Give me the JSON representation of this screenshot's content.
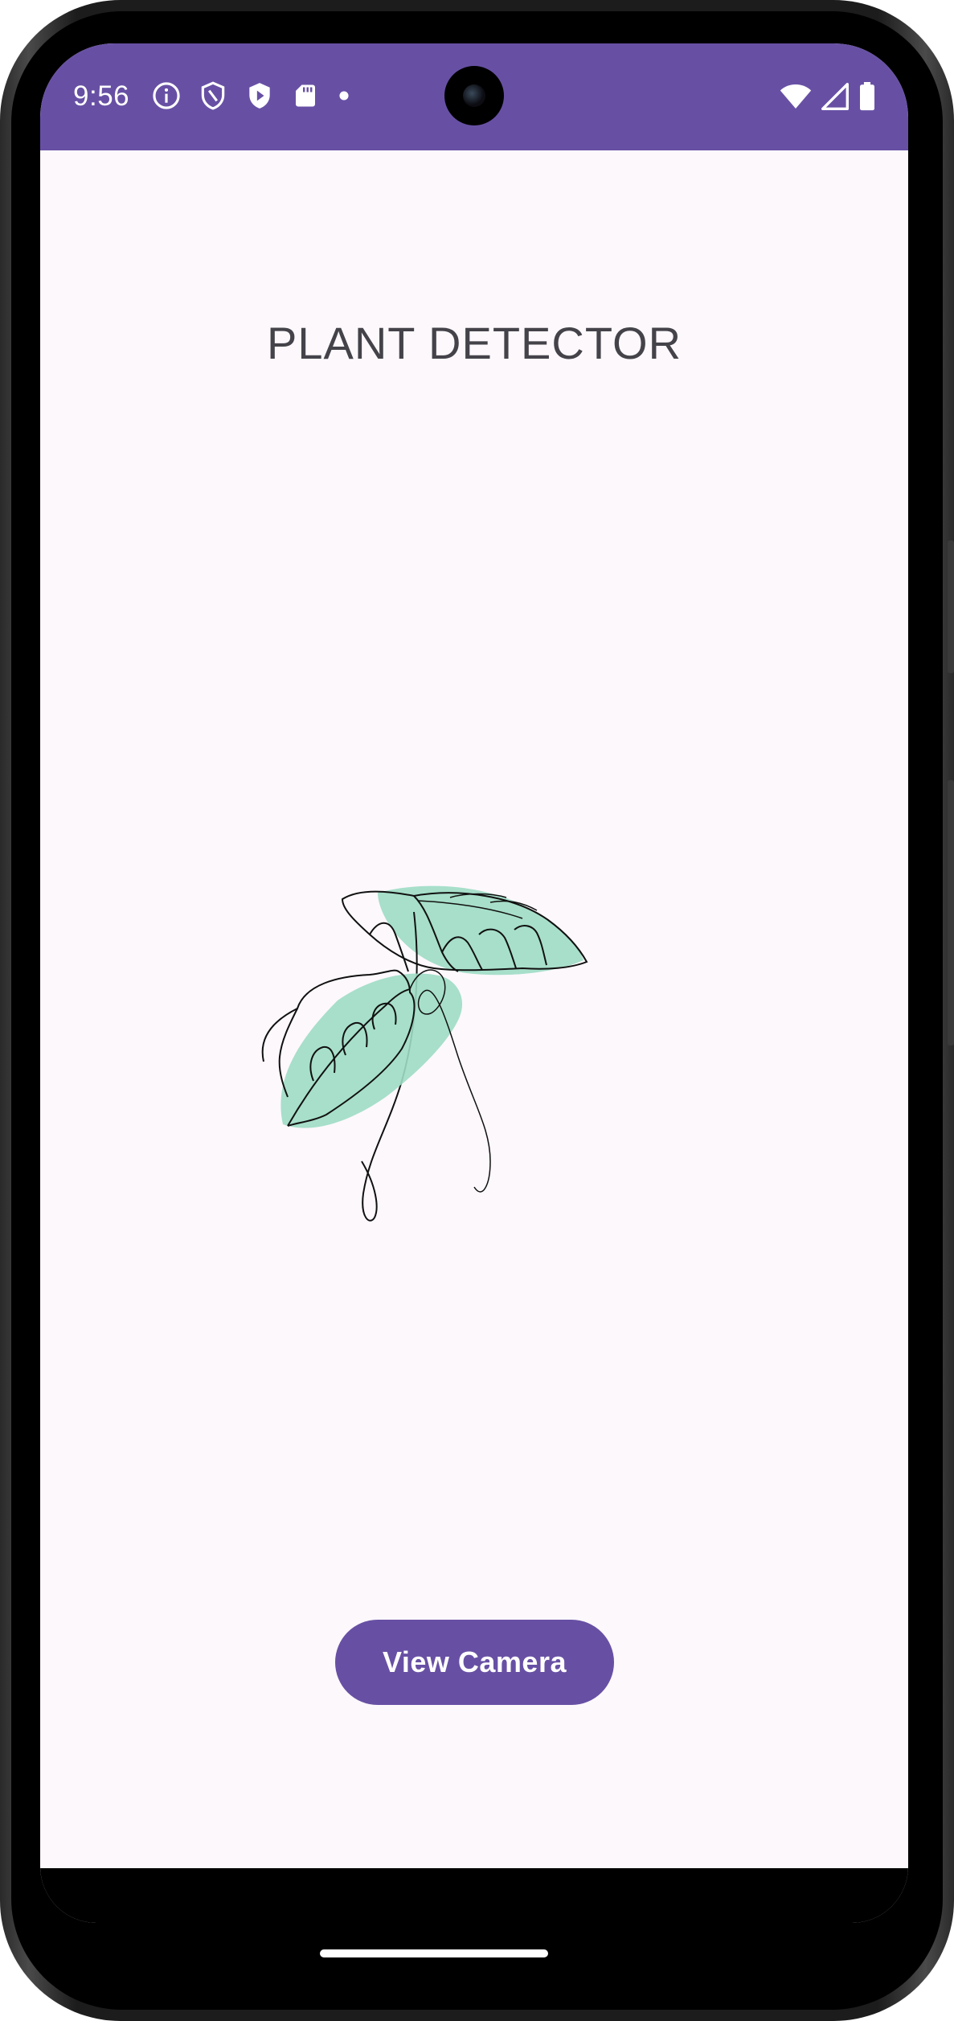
{
  "status_bar": {
    "time": "9:56",
    "left_icons": [
      "info-icon",
      "shield-icon",
      "play-protect-icon",
      "sd-card-icon",
      "dot-icon"
    ],
    "right_icons": [
      "wifi-icon",
      "signal-icon",
      "battery-icon"
    ],
    "background_color": "#6750a4"
  },
  "main": {
    "title": "PLANT DETECTOR",
    "illustration": "plant-leaves-illustration",
    "cta_label": "View Camera"
  },
  "colors": {
    "accent": "#6750a4",
    "surface": "#fdf8fc",
    "leaf_fill": "#9ddcc4"
  }
}
